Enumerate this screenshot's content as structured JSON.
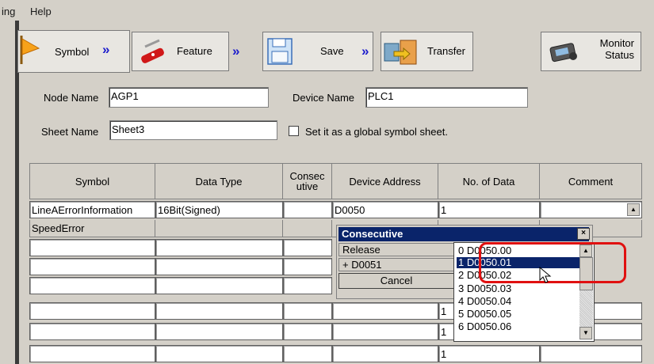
{
  "menu": {
    "item1": "ing",
    "item2": "Help"
  },
  "toolbar": {
    "symbol": "Symbol",
    "feature": "Feature",
    "save": "Save",
    "transfer": "Transfer",
    "monitor_line1": "Monitor",
    "monitor_line2": "Status",
    "arrow": "»"
  },
  "form": {
    "node_name_label": "Node Name",
    "node_name_value": "AGP1",
    "device_name_label": "Device Name",
    "device_name_value": "PLC1",
    "sheet_name_label": "Sheet Name",
    "sheet_name_value": "Sheet3",
    "global_checkbox_label": "Set it as a global symbol sheet."
  },
  "table": {
    "headers": {
      "symbol": "Symbol",
      "data_type": "Data Type",
      "consec_line1": "Consec",
      "consec_line2": "utive",
      "device_address": "Device Address",
      "no_of_data": "No. of Data",
      "comment": "Comment"
    },
    "rows": [
      {
        "symbol": "LineAErrorInformation",
        "data_type": "16Bit(Signed)",
        "device_address": "D0050",
        "no_of_data": "1"
      },
      {
        "symbol": "SpeedError"
      }
    ],
    "partial_no_of_data": [
      "1",
      "1",
      "1"
    ]
  },
  "popup": {
    "title": "Consecutive",
    "close": "×",
    "release": "Release",
    "plus_item": "+  D0051",
    "cancel": "Cancel"
  },
  "listbox": {
    "items": [
      "0  D0050.00",
      "1  D0050.01",
      "2  D0050.02",
      "3  D0050.03",
      "4  D0050.04",
      "5  D0050.05",
      "6  D0050.06"
    ],
    "selected_index": 1
  },
  "colors": {
    "selection": "#0a246a",
    "highlight_outline": "#e01010",
    "arrow_blue": "#1a1acc"
  }
}
